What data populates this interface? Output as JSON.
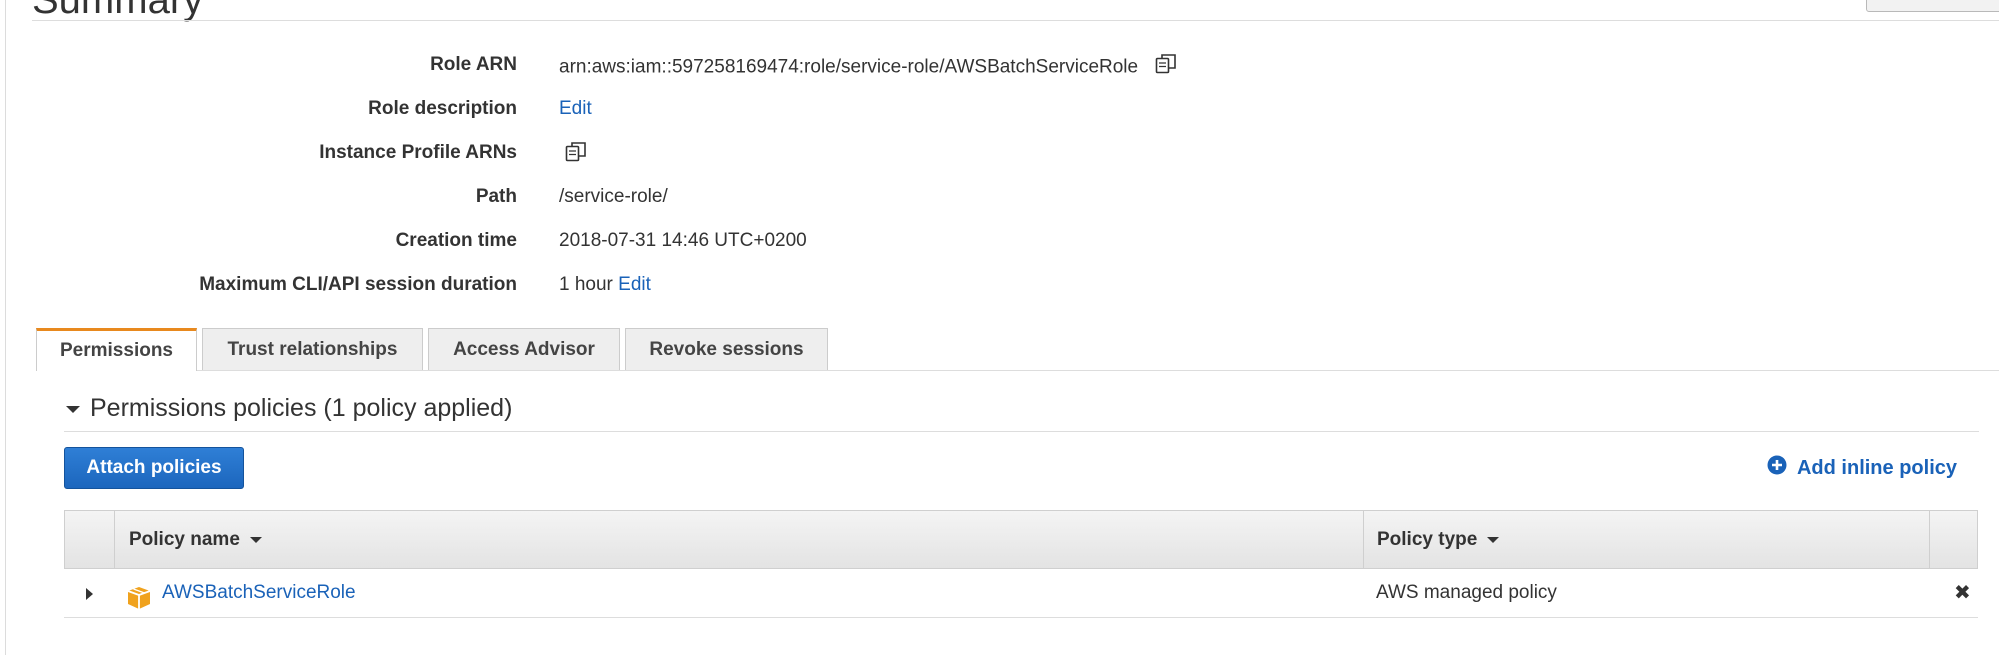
{
  "header": {
    "title": "Summary"
  },
  "summary": {
    "rows": [
      {
        "label": "Role ARN",
        "value": "arn:aws:iam::597258169474:role/service-role/AWSBatchServiceRole"
      },
      {
        "label": "Role description",
        "link": "Edit"
      },
      {
        "label": "Instance Profile ARNs"
      },
      {
        "label": "Path",
        "value": "/service-role/"
      },
      {
        "label": "Creation time",
        "value": "2018-07-31 14:46 UTC+0200"
      },
      {
        "label": "Maximum CLI/API session duration",
        "value": "1 hour",
        "link": "Edit"
      }
    ]
  },
  "tabs": [
    {
      "label": "Permissions",
      "active": true
    },
    {
      "label": "Trust relationships"
    },
    {
      "label": "Access Advisor"
    },
    {
      "label": "Revoke sessions"
    }
  ],
  "permissions": {
    "section_title": "Permissions policies (1 policy applied)",
    "attach_button": "Attach policies",
    "add_inline": "Add inline policy",
    "table": {
      "columns": [
        "Policy name",
        "Policy type"
      ],
      "rows": [
        {
          "name": "AWSBatchServiceRole",
          "type": "AWS managed policy"
        }
      ]
    },
    "remove_glyph": "✖"
  },
  "colors": {
    "link": "#1a62b8",
    "primary_button": "#1c66bd",
    "active_tab_accent": "#e8891e",
    "package_icon": "#f0a21d"
  }
}
